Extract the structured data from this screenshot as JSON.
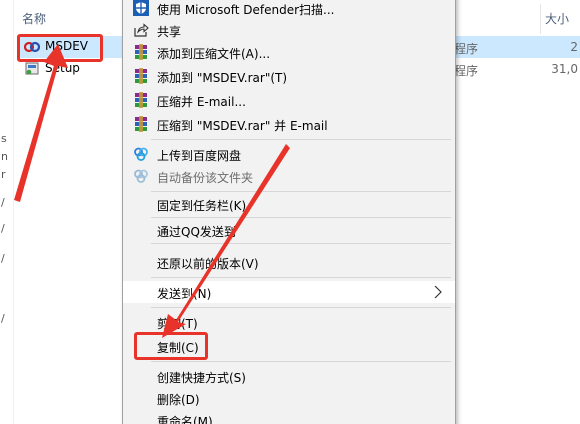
{
  "explorer": {
    "header": {
      "name_col": "名称",
      "size_col": "大小"
    },
    "files": [
      {
        "name": "MSDEV",
        "type": "程序",
        "size": "2",
        "selected": true
      },
      {
        "name": "Setup",
        "type": "程序",
        "size": "31,0"
      }
    ],
    "left_pane_glyphs": [
      "s",
      "n",
      "r",
      "/",
      "/",
      "/",
      "/"
    ]
  },
  "context_menu": {
    "items": [
      {
        "id": "defender",
        "label": "使用 Microsoft Defender扫描...",
        "icon": "defender-shield-icon"
      },
      {
        "id": "share",
        "label": "共享",
        "icon": "share-icon"
      },
      {
        "id": "add-archive",
        "label": "添加到压缩文件(A)...",
        "icon": "winrar-icon"
      },
      {
        "id": "add-rar",
        "label": "添加到 \"MSDEV.rar\"(T)",
        "icon": "winrar-icon"
      },
      {
        "id": "compress-email",
        "label": "压缩并 E-mail...",
        "icon": "winrar-icon"
      },
      {
        "id": "compress-rar-email",
        "label": "压缩到 \"MSDEV.rar\" 并 E-mail",
        "icon": "winrar-icon"
      },
      {
        "id": "upload-baidu",
        "label": "上传到百度网盘",
        "icon": "baidu-netdisk-icon"
      },
      {
        "id": "auto-backup",
        "label": "自动备份该文件夹",
        "icon": "baidu-netdisk-icon",
        "disabled": true
      },
      {
        "id": "pin-taskbar",
        "label": "固定到任务栏(K)"
      },
      {
        "id": "send-qq",
        "label": "通过QQ发送到"
      },
      {
        "id": "restore",
        "label": "还原以前的版本(V)"
      },
      {
        "id": "send-to",
        "label": "发送到(N)",
        "submenu": true
      },
      {
        "id": "cut",
        "label": "剪切(T)"
      },
      {
        "id": "copy",
        "label": "复制(C)"
      },
      {
        "id": "create-shortcut",
        "label": "创建快捷方式(S)"
      },
      {
        "id": "delete",
        "label": "删除(D)"
      },
      {
        "id": "rename",
        "label": "重命名(M)"
      }
    ]
  },
  "colors": {
    "annotation_red": "#e8332a",
    "selection_blue": "#cce8ff",
    "menu_bg": "#f2f2f2"
  }
}
